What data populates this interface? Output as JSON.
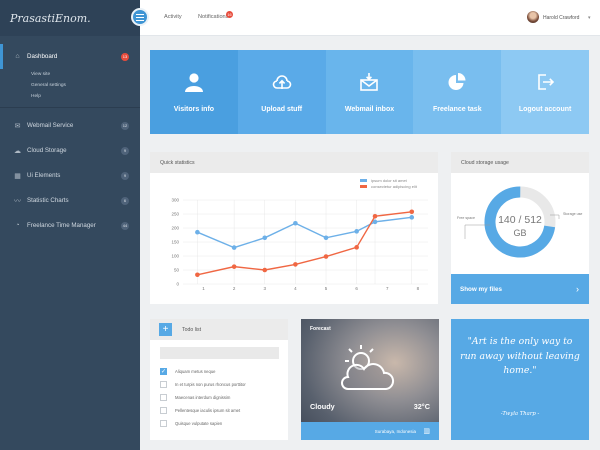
{
  "app": {
    "logo_text": "PrasastiEnom."
  },
  "sidebar": {
    "items": [
      {
        "label": "Dashboard",
        "count": "13",
        "active": true,
        "icon": "home-icon"
      },
      {
        "label": "Webmail Service",
        "count": "12",
        "icon": "mail-icon"
      },
      {
        "label": "Cloud Storage",
        "count": "9",
        "icon": "cloud-icon"
      },
      {
        "label": "Ui Elements",
        "count": "9",
        "icon": "grid-icon"
      },
      {
        "label": "Statistic Charts",
        "count": "6",
        "icon": "chart-icon"
      },
      {
        "label": "Freelance Time Manager",
        "count": "44",
        "icon": "pie-icon"
      }
    ],
    "dashboard_sub": [
      "View site",
      "General settings",
      "Help"
    ]
  },
  "topbar": {
    "activity": "Activity",
    "notifications": "Notifications",
    "notif_count": "16",
    "user_name": "Harold Crawford"
  },
  "tiles": [
    {
      "label": "Visitors info",
      "icon": "user-icon",
      "color": "#4a9fe0"
    },
    {
      "label": "Upload stuff",
      "icon": "upload-icon",
      "color": "#5aaae8"
    },
    {
      "label": "Webmail inbox",
      "icon": "inbox-icon",
      "color": "#69b5ec"
    },
    {
      "label": "Freelance task",
      "icon": "pie-icon",
      "color": "#79beef"
    },
    {
      "label": "Logout account",
      "icon": "logout-icon",
      "color": "#8dc9f3"
    }
  ],
  "quick_stats": {
    "title": "Quick statistics"
  },
  "chart_data": {
    "type": "line",
    "x": [
      1,
      2,
      3,
      4,
      5,
      6,
      7,
      8
    ],
    "x_plot": [
      0.8,
      2,
      3,
      4,
      5,
      6,
      6.6,
      7.8
    ],
    "series": [
      {
        "name": "ipsum dolor sit amet",
        "color": "#6db0e8",
        "values": [
          185,
          130,
          165,
          217,
          165,
          188,
          222,
          238
        ]
      },
      {
        "name": "consectetur adipiscing elit",
        "color": "#f06743",
        "values": [
          33,
          62,
          50,
          70,
          98,
          131,
          242,
          258
        ]
      }
    ],
    "yticks": [
      0,
      50,
      100,
      150,
      200,
      250,
      300
    ],
    "ylim": [
      0,
      300
    ],
    "grid": true,
    "legend_position": "top-right"
  },
  "cloud": {
    "title": "Cloud storage usage",
    "usage": "140 / 512",
    "unit": "GB",
    "used_fraction": 0.2734,
    "free_label": "Free space",
    "used_label": "Storage use",
    "show_files": "Show my files"
  },
  "todo": {
    "title": "Todo list",
    "items": [
      {
        "text": "Aliquam metus neque",
        "checked": true
      },
      {
        "text": "In et turpis non purus rhoncus porttitor",
        "checked": false
      },
      {
        "text": "Maecenas interdum dignissim",
        "checked": false
      },
      {
        "text": "Pellentesque iaculis ipsum sit amet",
        "checked": false
      },
      {
        "text": "Quisque vulputate sapien",
        "checked": false
      }
    ]
  },
  "forecast": {
    "label": "Forecast",
    "condition": "Cloudy",
    "temperature": "32°C",
    "location": "Surabaya, Indonesia"
  },
  "quote": {
    "text": "\"Art is the only way to run away without leaving home.\"",
    "author": "-Twyla Tharp -"
  }
}
